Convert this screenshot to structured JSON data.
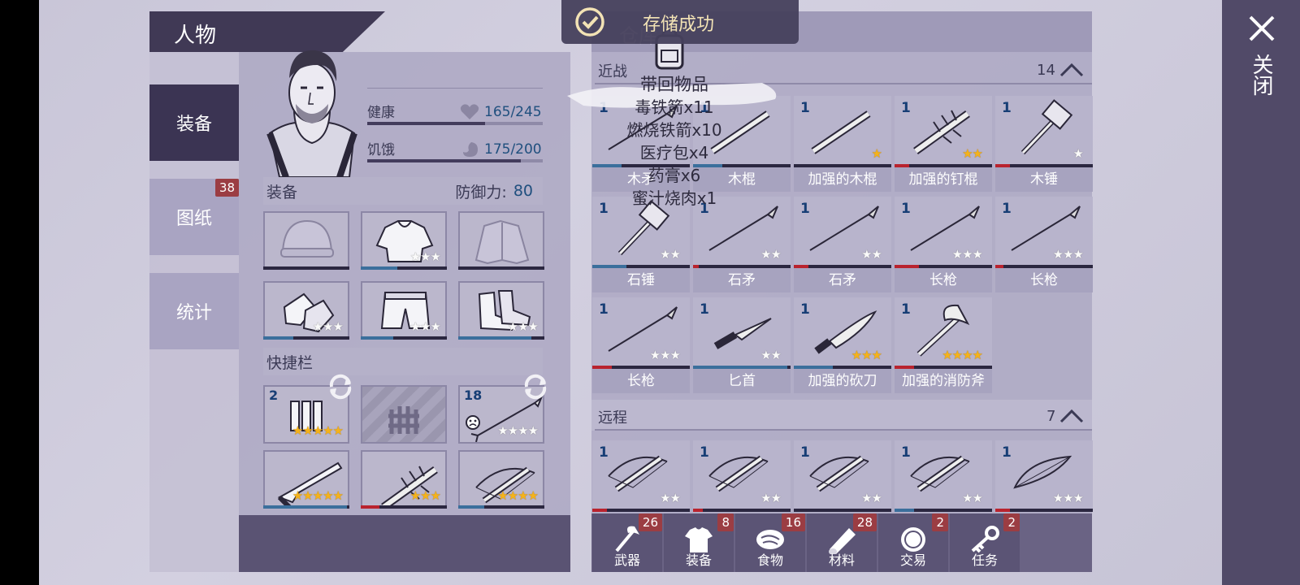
{
  "toast": {
    "text": "存储成功"
  },
  "close": {
    "label": "关闭"
  },
  "character": {
    "title": "人物",
    "stats": [
      {
        "label": "健康",
        "value": "165/245",
        "fraction": 0.67
      },
      {
        "label": "饥饿",
        "value": "175/200",
        "fraction": 0.875
      }
    ],
    "equip_label": "装备",
    "defense_label": "防御力:",
    "defense_value": "80",
    "quickbar_label": "快捷栏"
  },
  "side_tabs": [
    {
      "label": "装备",
      "active": true
    },
    {
      "label": "图纸",
      "badge": "38"
    },
    {
      "label": "统计"
    }
  ],
  "equipment": [
    {
      "item": "beanie",
      "stars_w": 0,
      "stars_g": 0,
      "durability": 0
    },
    {
      "item": "hoodie",
      "stars_w": 3,
      "stars_g": 0,
      "durability": 0.42
    },
    {
      "item": "jacket",
      "stars_w": 0,
      "stars_g": 0,
      "durability": 0
    },
    {
      "item": "gloves",
      "stars_w": 3,
      "stars_g": 0,
      "durability": 0.35
    },
    {
      "item": "shorts",
      "stars_w": 3,
      "stars_g": 0,
      "durability": 0.38
    },
    {
      "item": "boots",
      "stars_w": 3,
      "stars_g": 0,
      "durability": 0.85
    }
  ],
  "quickbar": [
    {
      "count": "2",
      "item": "bolts",
      "stars_g": 5,
      "stars_w": 0,
      "durability": 0,
      "swap": true
    },
    {
      "count": "",
      "item": "locked",
      "stars_g": 0,
      "stars_w": 0,
      "durability": 0,
      "hatched": true
    },
    {
      "count": "18",
      "item": "arrow",
      "stars_g": 0,
      "stars_w": 4,
      "durability": 0,
      "swap": true,
      "sad": true
    },
    {
      "count": "",
      "item": "shotgun",
      "stars_g": 5,
      "stars_w": 0,
      "durability": 0.97
    },
    {
      "count": "",
      "item": "spiked-club",
      "stars_g": 3,
      "stars_w": 0,
      "durability": 0.22,
      "durcolor": "#b9232e"
    },
    {
      "count": "",
      "item": "crossbow",
      "stars_g": 4,
      "stars_w": 0,
      "durability": 0.3
    }
  ],
  "warehouse": {
    "title": "仓库"
  },
  "loot": {
    "title": "带回物品",
    "lines": [
      "毒铁箭x11",
      "燃烧铁箭x10",
      "医疗包x4",
      "药膏x6",
      "蜜汁烧肉x1"
    ]
  },
  "melee": {
    "label": "近战",
    "count": "14",
    "items": [
      {
        "count": "1",
        "name": "木矛",
        "item": "spear",
        "stars_g": 0,
        "stars_w": 0,
        "durability": 0.3,
        "durcolor": "#3b6f9c"
      },
      {
        "count": "1",
        "name": "木棍",
        "item": "stick",
        "stars_g": 0,
        "stars_w": 0,
        "durability": 0.3,
        "durcolor": "#3b6f9c"
      },
      {
        "count": "1",
        "name": "加强的木棍",
        "item": "stick",
        "stars_g": 1,
        "stars_w": 0,
        "durability": 0,
        "durcolor": "#b9232e"
      },
      {
        "count": "1",
        "name": "加强的钉棍",
        "item": "spiked-club",
        "stars_g": 2,
        "stars_w": 0,
        "durability": 0.15,
        "durcolor": "#b9232e"
      },
      {
        "count": "1",
        "name": "木锤",
        "item": "hammer",
        "stars_g": 0,
        "stars_w": 1,
        "durability": 0.15,
        "durcolor": "#b9232e"
      },
      {
        "count": "1",
        "name": "石锤",
        "item": "hammer",
        "stars_g": 0,
        "stars_w": 2,
        "durability": 0.35,
        "durcolor": "#3b6f9c"
      },
      {
        "count": "1",
        "name": "石矛",
        "item": "spear",
        "stars_g": 0,
        "stars_w": 2,
        "durability": 0.06,
        "durcolor": "#b9232e"
      },
      {
        "count": "1",
        "name": "石矛",
        "item": "spear",
        "stars_g": 0,
        "stars_w": 2,
        "durability": 0.15,
        "durcolor": "#b9232e"
      },
      {
        "count": "1",
        "name": "长枪",
        "item": "spear",
        "stars_g": 0,
        "stars_w": 3,
        "durability": 0.25,
        "durcolor": "#b9232e"
      },
      {
        "count": "1",
        "name": "长枪",
        "item": "spear",
        "stars_g": 0,
        "stars_w": 3,
        "durability": 0.08,
        "durcolor": "#b9232e"
      },
      {
        "count": "1",
        "name": "长枪",
        "item": "spear",
        "stars_g": 0,
        "stars_w": 3,
        "durability": 0.2,
        "durcolor": "#b9232e"
      },
      {
        "count": "1",
        "name": "匕首",
        "item": "knife",
        "stars_g": 0,
        "stars_w": 2,
        "durability": 0.97,
        "durcolor": "#3b6f9c"
      },
      {
        "count": "1",
        "name": "加强的砍刀",
        "item": "machete",
        "stars_g": 3,
        "stars_w": 0,
        "durability": 0.4,
        "durcolor": "#3b6f9c"
      },
      {
        "count": "1",
        "name": "加强的消防斧",
        "item": "axe",
        "stars_g": 4,
        "stars_w": 0,
        "durability": 0.2,
        "durcolor": "#b9232e"
      }
    ]
  },
  "ranged": {
    "label": "远程",
    "count": "7",
    "items": [
      {
        "count": "1",
        "item": "crossbow",
        "stars_g": 0,
        "stars_w": 2,
        "durability": 0.15,
        "durcolor": "#b9232e"
      },
      {
        "count": "1",
        "item": "crossbow",
        "stars_g": 0,
        "stars_w": 2,
        "durability": 0.1,
        "durcolor": "#b9232e"
      },
      {
        "count": "1",
        "item": "crossbow",
        "stars_g": 0,
        "stars_w": 2,
        "durability": 0,
        "durcolor": "#3b6f9c"
      },
      {
        "count": "1",
        "item": "crossbow",
        "stars_g": 0,
        "stars_w": 2,
        "durability": 0.2,
        "durcolor": "#3b6f9c"
      },
      {
        "count": "1",
        "item": "bow",
        "stars_g": 0,
        "stars_w": 3,
        "durability": 0.15,
        "durcolor": "#b9232e"
      }
    ]
  },
  "bottom_tabs": [
    {
      "label": "武器",
      "badge": "26",
      "icon": "axe-icon"
    },
    {
      "label": "装备",
      "badge": "8",
      "icon": "shirt-icon"
    },
    {
      "label": "食物",
      "badge": "16",
      "icon": "meat-icon"
    },
    {
      "label": "材料",
      "badge": "28",
      "icon": "log-icon"
    },
    {
      "label": "交易",
      "badge": "2",
      "icon": "coin-icon"
    },
    {
      "label": "任务",
      "badge": "2",
      "icon": "key-icon"
    }
  ]
}
